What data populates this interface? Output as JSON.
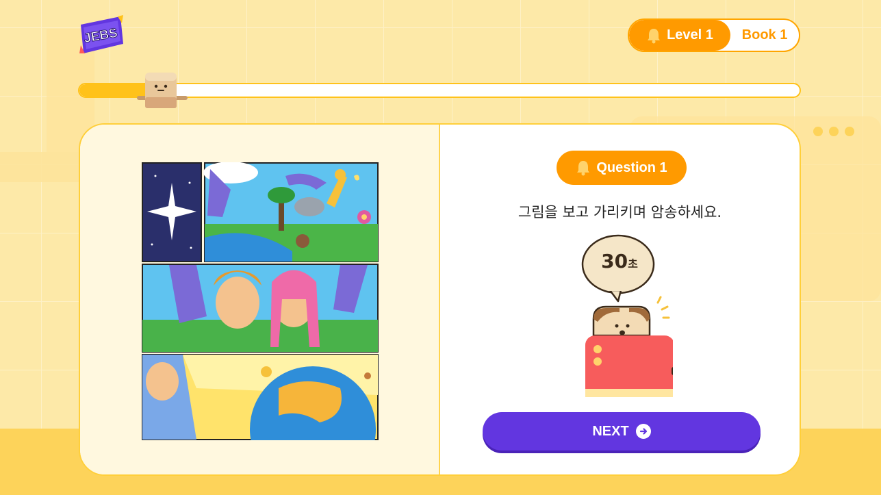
{
  "app": {
    "logo_text": "JEBS"
  },
  "header": {
    "level_label": "Level 1",
    "book_label": "Book 1",
    "level_icon": "bell-icon"
  },
  "progress": {
    "fraction": 0.1,
    "mascot_icon": "toast-mascot-icon"
  },
  "question": {
    "badge_label": "Question 1",
    "badge_icon": "bell-icon",
    "instruction": "그림을 보고 가리키며 암송하세요.",
    "timer_value": "30",
    "timer_unit": "초"
  },
  "actions": {
    "next_label": "NEXT",
    "next_icon": "arrow-right-circle-icon"
  },
  "colors": {
    "accent_orange": "#ff9a00",
    "progress_yellow": "#ffc21a",
    "button_purple": "#6236e0",
    "background": "#fde9a8"
  }
}
